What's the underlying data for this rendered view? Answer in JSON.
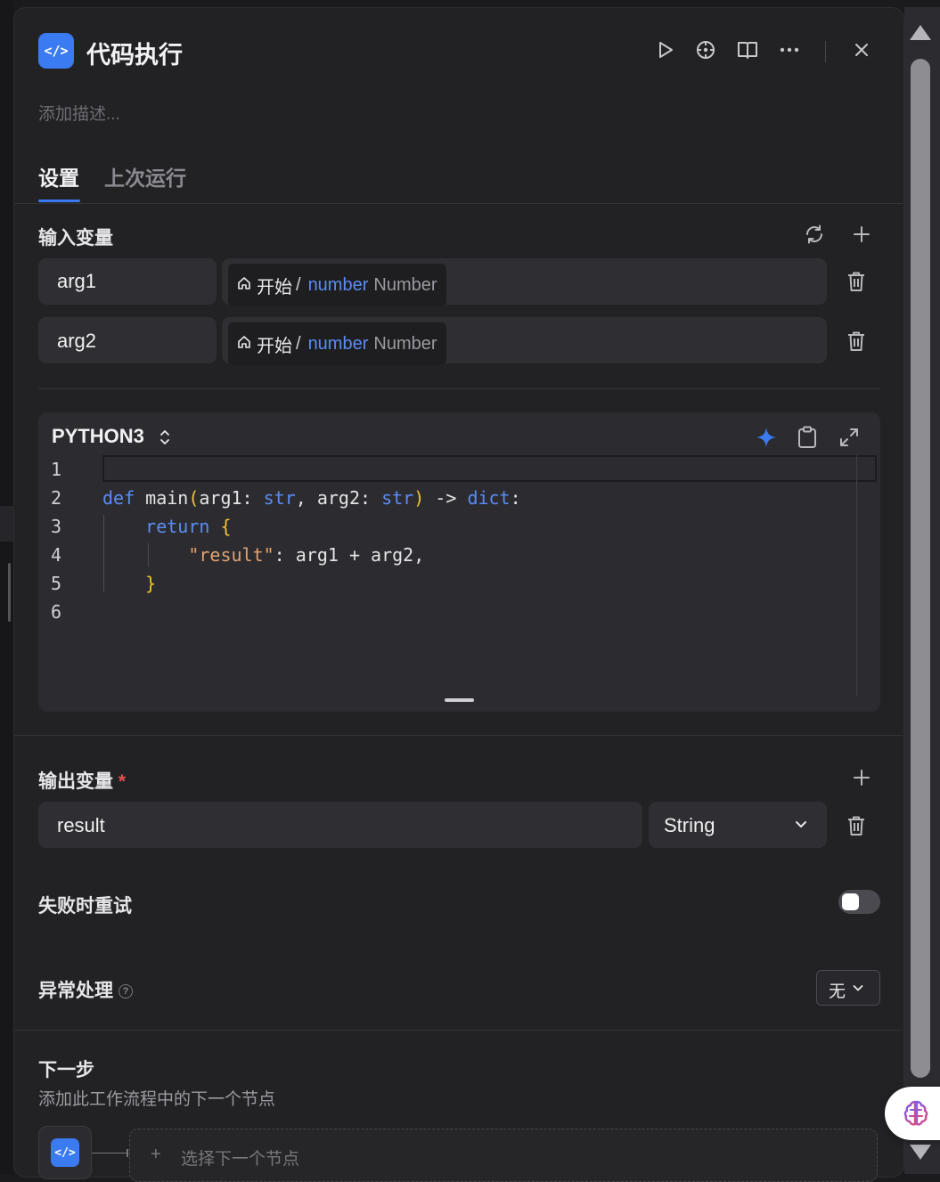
{
  "header": {
    "title": "代码执行",
    "description_placeholder": "添加描述...",
    "node_icon": "</>",
    "actions": [
      "run-icon",
      "locate-icon",
      "book-icon",
      "more-icon",
      "close-icon"
    ]
  },
  "tabs": [
    {
      "label": "设置",
      "active": true
    },
    {
      "label": "上次运行",
      "active": false
    }
  ],
  "inputs": {
    "title": "输入变量",
    "rows": [
      {
        "name": "arg1",
        "source_node": "开始",
        "separator": "/",
        "variable": "number",
        "type": "Number"
      },
      {
        "name": "arg2",
        "source_node": "开始",
        "separator": "/",
        "variable": "number",
        "type": "Number"
      }
    ]
  },
  "code": {
    "language": "PYTHON3",
    "line_numbers": [
      "1",
      "2",
      "3",
      "4",
      "5",
      "6"
    ],
    "lines": [
      "",
      "def main(arg1: str, arg2: str) -> dict:",
      "    return {",
      "        \"result\": arg1 + arg2,",
      "    }",
      ""
    ]
  },
  "outputs": {
    "title": "输出变量",
    "required_mark": "*",
    "rows": [
      {
        "name": "result",
        "type": "String"
      }
    ]
  },
  "retry": {
    "label": "失败时重试",
    "enabled": false
  },
  "error_handling": {
    "label": "异常处理",
    "value": "无"
  },
  "next_step": {
    "title": "下一步",
    "subtitle": "添加此工作流程中的下一个节点",
    "select_label": "选择下一个节点",
    "plus": "+"
  },
  "colors": {
    "accent": "#3a7bf1",
    "background": "#222225",
    "field": "#2f2f33",
    "required": "#e35050"
  }
}
